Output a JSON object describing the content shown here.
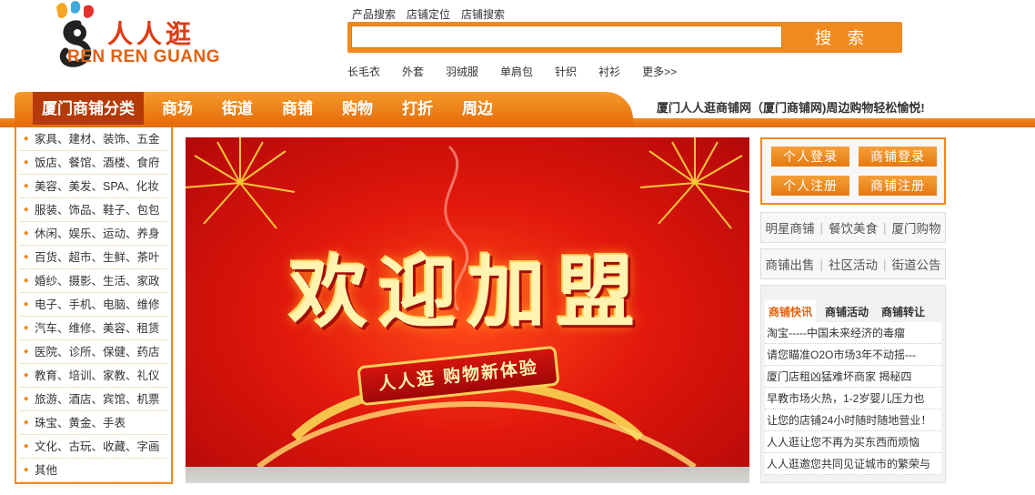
{
  "logo": {
    "cn_text": "人人逛",
    "en_text": "REN REN GUANG",
    "accent": "#f08a1e"
  },
  "search": {
    "tabs": [
      "产品搜索",
      "店铺定位",
      "店铺搜索"
    ],
    "placeholder": "",
    "button_label": "搜 索",
    "hot_words": [
      "长毛衣",
      "外套",
      "羽绒服",
      "单肩包",
      "针织",
      "衬衫",
      "更多>>"
    ]
  },
  "nav": {
    "items": [
      "厦门商铺分类",
      "商场",
      "街道",
      "商铺",
      "购物",
      "打折",
      "周边"
    ],
    "slogan": "厦门人人逛商铺网（厦门商铺网)周边购物轻松愉悦!"
  },
  "categories": [
    "家具、建材、装饰、五金",
    "饭店、餐馆、酒楼、食府",
    "美容、美发、SPA、化妆",
    "服装、饰品、鞋子、包包",
    "休闲、娱乐、运动、养身",
    "百货、超市、生鲜、茶叶",
    "婚纱、摄影、生活、家政",
    "电子、手机、电脑、维修",
    "汽车、维修、美容、租赁",
    "医院、诊所、保健、药店",
    "教育、培训、家教、礼仪",
    "旅游、酒店、宾馆、机票",
    "珠宝、黄金、手表",
    "文化、古玩、收藏、字画",
    "其他"
  ],
  "banner": {
    "title": "欢迎加盟",
    "ribbon": "人人逛  购物新体验"
  },
  "login": {
    "personal_login": "个人登录",
    "shop_login": "商铺登录",
    "personal_register": "个人注册",
    "shop_register": "商铺注册"
  },
  "quick_links_1": [
    "明星商铺",
    "餐饮美食",
    "厦门购物"
  ],
  "quick_links_2": [
    "商铺出售",
    "社区活动",
    "街道公告"
  ],
  "news": {
    "tabs": [
      "商铺快讯",
      "商铺活动",
      "商铺转让"
    ],
    "items": [
      "淘宝-----中国未来经济的毒瘤",
      "请您瞄准O2O市场3年不动摇---",
      "厦门店租凶猛难坏商家 揭秘四",
      "早教市场火热，1-2岁婴儿压力也",
      "让您的店铺24小时随时随地营业！",
      "人人逛让您不再为买东西而烦恼",
      "人人逛邀您共同见证城市的繁荣与"
    ]
  }
}
